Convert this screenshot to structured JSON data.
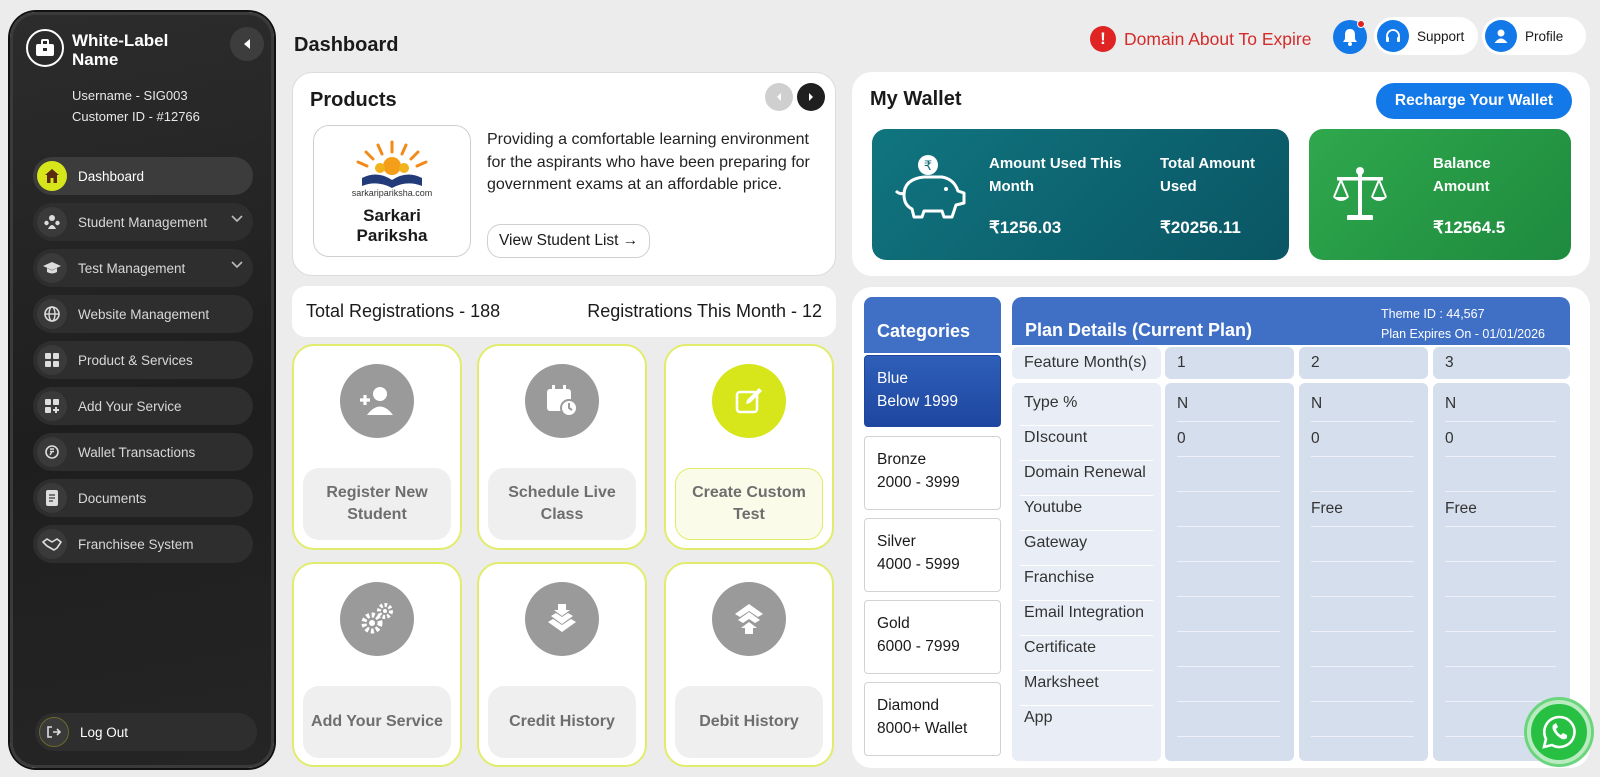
{
  "sidebar": {
    "brand": "White-Label Name",
    "username": "Username - SIG003",
    "customer_id": "Customer ID - #12766",
    "items": [
      {
        "label": "Dashboard",
        "icon": "home-icon"
      },
      {
        "label": "Student Management",
        "icon": "students-icon",
        "expandable": true
      },
      {
        "label": "Test Management",
        "icon": "graduation-cap-icon",
        "expandable": true
      },
      {
        "label": "Website Management",
        "icon": "globe-icon"
      },
      {
        "label": "Product & Services",
        "icon": "grid-icon"
      },
      {
        "label": "Add Your Service",
        "icon": "add-grid-icon"
      },
      {
        "label": "Wallet Transactions",
        "icon": "wallet-transactions-icon"
      },
      {
        "label": "Documents",
        "icon": "document-icon"
      },
      {
        "label": "Franchisee System",
        "icon": "handshake-icon"
      }
    ],
    "logout": "Log Out"
  },
  "header": {
    "title": "Dashboard",
    "alert": "Domain About To Expire",
    "support": "Support",
    "profile": "Profile"
  },
  "products": {
    "title": "Products",
    "logo_site": "sarkaripariksha.com",
    "name": "Sarkari Pariksha",
    "description": "Providing a comfortable learning environment for the aspirants who have been preparing for government exams at an affordable price.",
    "view_button": "View Student List →"
  },
  "registrations": {
    "total": "Total Registrations - 188",
    "month": "Registrations This Month - 12"
  },
  "tiles": [
    {
      "label": "Register New Student",
      "icon": "add-user-icon"
    },
    {
      "label": "Schedule Live Class",
      "icon": "calendar-clock-icon"
    },
    {
      "label": "Create Custom Test",
      "icon": "edit-icon",
      "highlighted": true
    },
    {
      "label": "Add Your Service",
      "icon": "gears-icon"
    },
    {
      "label": "Credit History",
      "icon": "credit-icon"
    },
    {
      "label": "Debit History",
      "icon": "debit-icon"
    }
  ],
  "wallet": {
    "title": "My Wallet",
    "recharge": "Recharge Your Wallet",
    "used_month_label": "Amount  Used This Month",
    "used_month_value": "₹1256.03",
    "total_used_label": "Total Amount Used",
    "total_used_value": "₹20256.11",
    "balance_label": "Balance Amount",
    "balance_value": "₹12564.5"
  },
  "plan": {
    "categories_title": "Categories",
    "categories": [
      {
        "name": "Blue",
        "range": "Below 1999",
        "selected": true
      },
      {
        "name": "Bronze",
        "range": "2000 - 3999"
      },
      {
        "name": "Silver",
        "range": "4000 - 5999"
      },
      {
        "name": "Gold",
        "range": "6000 - 7999"
      },
      {
        "name": "Diamond",
        "range": "8000+ Wallet"
      }
    ],
    "title": "Plan Details (Current Plan)",
    "theme_id": "Theme ID : 44,567",
    "expires": "Plan Expires On - 01/01/2026",
    "month_header": "Feature Month(s)",
    "months": [
      "1",
      "2",
      "3"
    ],
    "features": [
      "Type %",
      "DIscount",
      "Domain Renewal",
      "Youtube",
      "Gateway",
      "Franchise",
      "Email Integration",
      "Certificate",
      "Marksheet",
      "App"
    ],
    "values": [
      [
        "N",
        "0",
        "",
        "",
        "",
        "",
        "",
        "",
        "",
        ""
      ],
      [
        "N",
        "0",
        "",
        "Free",
        "",
        "",
        "",
        "",
        "",
        ""
      ],
      [
        "N",
        "0",
        "",
        "Free",
        "",
        "",
        "",
        "",
        "",
        ""
      ]
    ]
  },
  "colors": {
    "accent": "#1378e8",
    "lime": "#d6e61b",
    "wallet_teal": "#0e6b77",
    "balance_green": "#27a047",
    "plan_blue": "#3f70c5",
    "alert_red": "#d42c2c"
  }
}
